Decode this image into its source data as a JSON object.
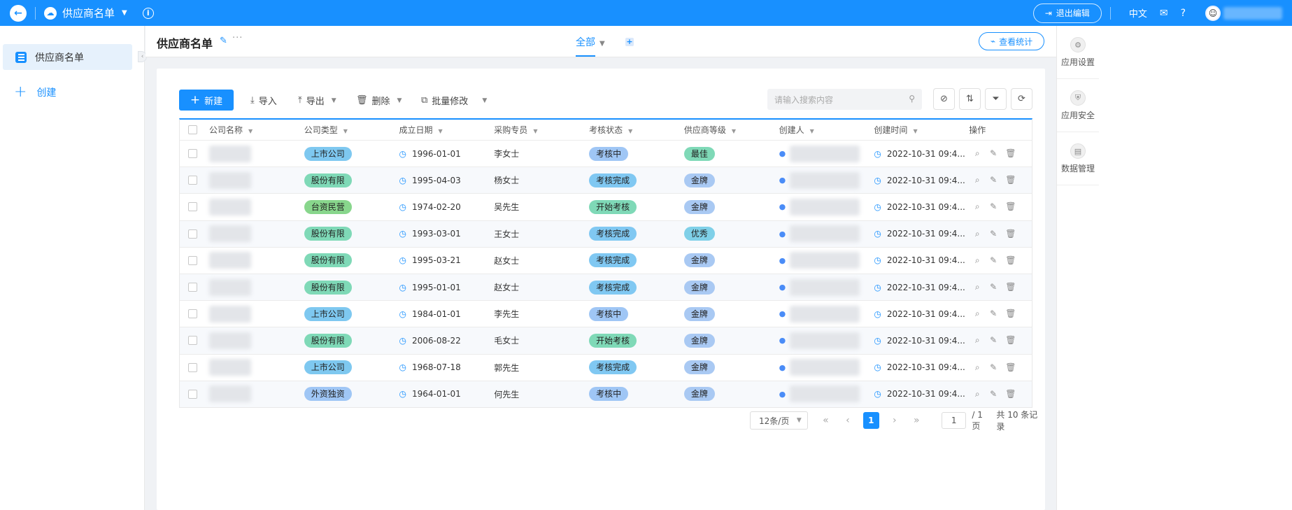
{
  "app": {
    "title": "供应商名单",
    "exit_edit": "退出编辑",
    "lang": "中文"
  },
  "sidebar": {
    "items": [
      {
        "label": "供应商名单"
      }
    ],
    "create_label": "创建"
  },
  "header": {
    "page_title": "供应商名单",
    "view_tab": "全部",
    "stats_button": "查看统计"
  },
  "rail": {
    "items": [
      {
        "label": "应用设置",
        "icon": "gear-icon"
      },
      {
        "label": "应用安全",
        "icon": "shield-icon"
      },
      {
        "label": "数据管理",
        "icon": "database-icon"
      }
    ]
  },
  "toolbar": {
    "new_label": "新建",
    "import_label": "导入",
    "export_label": "导出",
    "delete_label": "删除",
    "batch_label": "批量修改",
    "search_placeholder": "请输入搜索内容"
  },
  "table": {
    "columns": [
      "公司名称",
      "公司类型",
      "成立日期",
      "采购专员",
      "考核状态",
      "供应商等级",
      "创建人",
      "创建时间",
      "操作"
    ],
    "rows": [
      {
        "type": "上市公司",
        "type_color": "#7ec8f0",
        "date": "1996-01-01",
        "buyer": "李女士",
        "status": "考核中",
        "status_color": "#9fc6f5",
        "level": "最佳",
        "level_color": "#7fd9b7",
        "created": "2022-10-31 09:4..."
      },
      {
        "type": "股份有限",
        "type_color": "#7fd9b7",
        "date": "1995-04-03",
        "buyer": "杨女士",
        "status": "考核完成",
        "status_color": "#80c8f2",
        "level": "金牌",
        "level_color": "#a9c9f3",
        "created": "2022-10-31 09:4..."
      },
      {
        "type": "台资民营",
        "type_color": "#88d68c",
        "date": "1974-02-20",
        "buyer": "吴先生",
        "status": "开始考核",
        "status_color": "#7fd9b7",
        "level": "金牌",
        "level_color": "#a9c9f3",
        "created": "2022-10-31 09:4..."
      },
      {
        "type": "股份有限",
        "type_color": "#7fd9b7",
        "date": "1993-03-01",
        "buyer": "王女士",
        "status": "考核完成",
        "status_color": "#80c8f2",
        "level": "优秀",
        "level_color": "#7fd0e8",
        "created": "2022-10-31 09:4..."
      },
      {
        "type": "股份有限",
        "type_color": "#7fd9b7",
        "date": "1995-03-21",
        "buyer": "赵女士",
        "status": "考核完成",
        "status_color": "#80c8f2",
        "level": "金牌",
        "level_color": "#a9c9f3",
        "created": "2022-10-31 09:4..."
      },
      {
        "type": "股份有限",
        "type_color": "#7fd9b7",
        "date": "1995-01-01",
        "buyer": "赵女士",
        "status": "考核完成",
        "status_color": "#80c8f2",
        "level": "金牌",
        "level_color": "#a9c9f3",
        "created": "2022-10-31 09:4..."
      },
      {
        "type": "上市公司",
        "type_color": "#7ec8f0",
        "date": "1984-01-01",
        "buyer": "李先生",
        "status": "考核中",
        "status_color": "#9fc6f5",
        "level": "金牌",
        "level_color": "#a9c9f3",
        "created": "2022-10-31 09:4..."
      },
      {
        "type": "股份有限",
        "type_color": "#7fd9b7",
        "date": "2006-08-22",
        "buyer": "毛女士",
        "status": "开始考核",
        "status_color": "#7fd9b7",
        "level": "金牌",
        "level_color": "#a9c9f3",
        "created": "2022-10-31 09:4..."
      },
      {
        "type": "上市公司",
        "type_color": "#7ec8f0",
        "date": "1968-07-18",
        "buyer": "郭先生",
        "status": "考核完成",
        "status_color": "#80c8f2",
        "level": "金牌",
        "level_color": "#a9c9f3",
        "created": "2022-10-31 09:4..."
      },
      {
        "type": "外资独资",
        "type_color": "#9fc6f5",
        "date": "1964-01-01",
        "buyer": "何先生",
        "status": "考核中",
        "status_color": "#9fc6f5",
        "level": "金牌",
        "level_color": "#a9c9f3",
        "created": "2022-10-31 09:4..."
      }
    ]
  },
  "pagination": {
    "page_size": "12条/页",
    "current_page": "1",
    "page_input": "1",
    "total_pages": "/ 1页",
    "total_records": "共 10 条记录"
  },
  "colors": {
    "primary": "#1890ff"
  }
}
